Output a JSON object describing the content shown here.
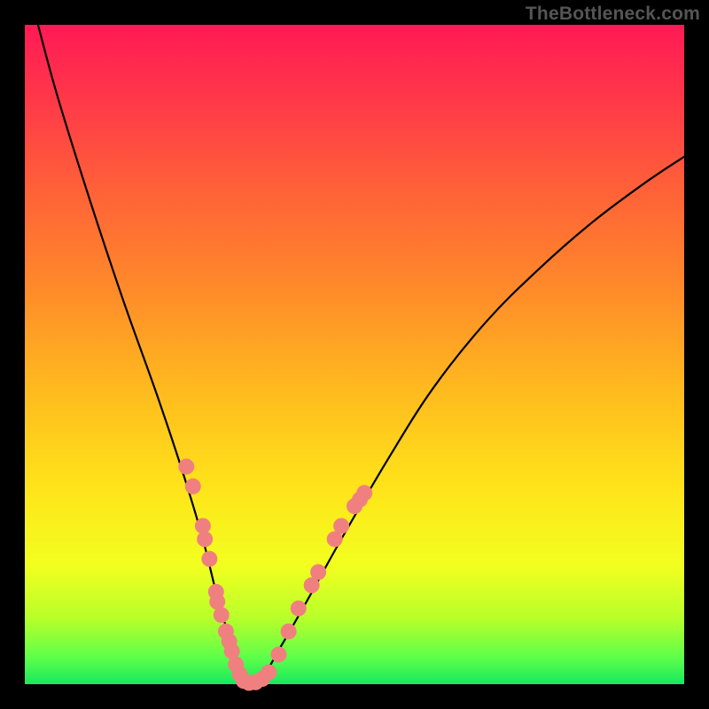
{
  "watermark": "TheBottleneck.com",
  "chart_data": {
    "type": "line",
    "title": "",
    "xlabel": "",
    "ylabel": "",
    "xlim": [
      0,
      100
    ],
    "ylim": [
      0,
      100
    ],
    "grid": false,
    "series": [
      {
        "name": "curve",
        "color": "#000000",
        "x": [
          2,
          5,
          10,
          15,
          20,
          24,
          27,
          29,
          31,
          32.5,
          34,
          36,
          39,
          43,
          48,
          55,
          62,
          70,
          78,
          86,
          94,
          100
        ],
        "y": [
          100,
          89,
          73,
          58,
          44,
          32,
          22,
          14,
          7,
          2,
          0,
          1,
          6,
          13,
          22,
          34,
          45,
          55,
          63,
          70,
          76,
          80
        ]
      }
    ],
    "markers": [
      {
        "name": "dots-left",
        "color": "#f08080",
        "radius_px": 9,
        "points": [
          {
            "x": 24.5,
            "y": 33
          },
          {
            "x": 25.5,
            "y": 30
          },
          {
            "x": 27.0,
            "y": 24
          },
          {
            "x": 27.3,
            "y": 22
          },
          {
            "x": 28.0,
            "y": 19
          },
          {
            "x": 29.0,
            "y": 14
          },
          {
            "x": 29.2,
            "y": 12.5
          },
          {
            "x": 29.8,
            "y": 10.5
          },
          {
            "x": 30.5,
            "y": 8
          },
          {
            "x": 31.0,
            "y": 6.5
          },
          {
            "x": 31.4,
            "y": 5
          },
          {
            "x": 32.0,
            "y": 3
          },
          {
            "x": 32.6,
            "y": 1.5
          }
        ]
      },
      {
        "name": "dots-bottom",
        "color": "#f08080",
        "radius_px": 9,
        "points": [
          {
            "x": 33.2,
            "y": 0.5
          },
          {
            "x": 34.0,
            "y": 0.2
          },
          {
            "x": 35.0,
            "y": 0.3
          },
          {
            "x": 36.0,
            "y": 0.8
          },
          {
            "x": 37.0,
            "y": 1.8
          }
        ]
      },
      {
        "name": "dots-right",
        "color": "#f08080",
        "radius_px": 9,
        "points": [
          {
            "x": 38.5,
            "y": 4.5
          },
          {
            "x": 40.0,
            "y": 8
          },
          {
            "x": 41.5,
            "y": 11.5
          },
          {
            "x": 43.5,
            "y": 15
          },
          {
            "x": 44.5,
            "y": 17
          },
          {
            "x": 47.0,
            "y": 22
          },
          {
            "x": 48.0,
            "y": 24
          },
          {
            "x": 50.0,
            "y": 27
          },
          {
            "x": 50.8,
            "y": 28
          },
          {
            "x": 51.5,
            "y": 29
          }
        ]
      }
    ]
  }
}
